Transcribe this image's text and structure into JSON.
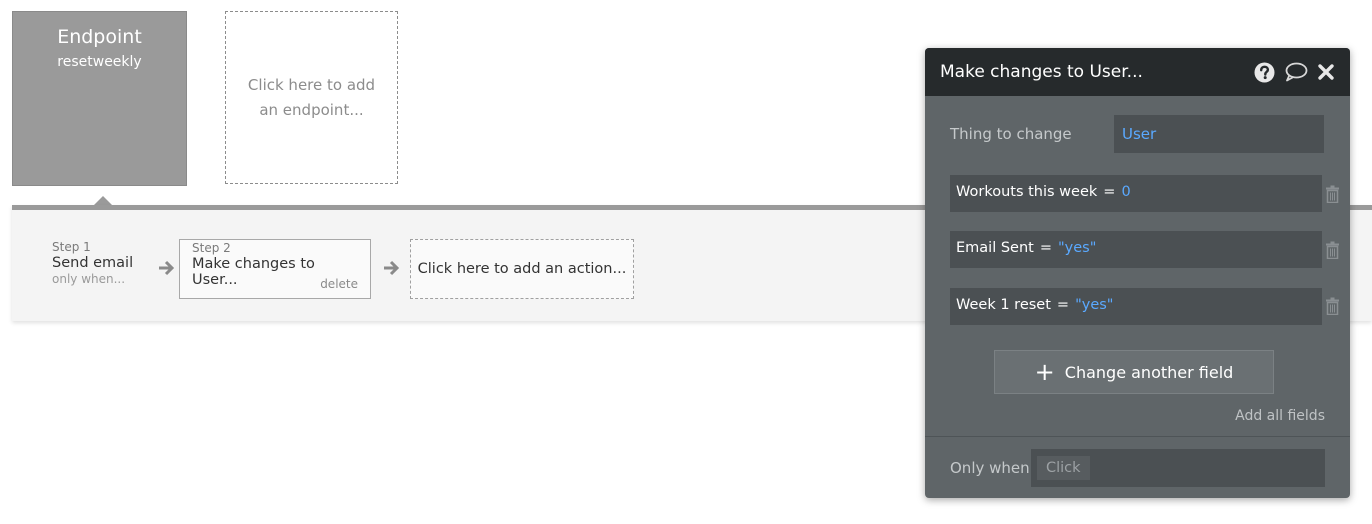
{
  "endpoint": {
    "title": "Endpoint",
    "name": "resetweekly"
  },
  "add_endpoint": {
    "label": "Click here to add an endpoint..."
  },
  "workflow": {
    "steps": [
      {
        "label": "Step 1",
        "title": "Send email",
        "sub": "only when..."
      },
      {
        "label": "Step 2",
        "title": "Make changes to User...",
        "delete": "delete"
      }
    ],
    "add_action": "Click here to add an action..."
  },
  "panel": {
    "title": "Make changes to User...",
    "thing_label": "Thing to change",
    "thing_value": "User",
    "fields": [
      {
        "name": "Workouts this week",
        "eq": "=",
        "value": "0"
      },
      {
        "name": "Email Sent",
        "eq": "=",
        "value": "\"yes\""
      },
      {
        "name": "Week 1 reset",
        "eq": "=",
        "value": "\"yes\""
      }
    ],
    "change_field_label": "Change another field",
    "add_all_fields": "Add all fields",
    "only_when_label": "Only when",
    "only_when_chip": "Click",
    "icons": [
      "help-icon",
      "comment-icon",
      "close-icon"
    ],
    "value_color": "#5aa9ff"
  }
}
